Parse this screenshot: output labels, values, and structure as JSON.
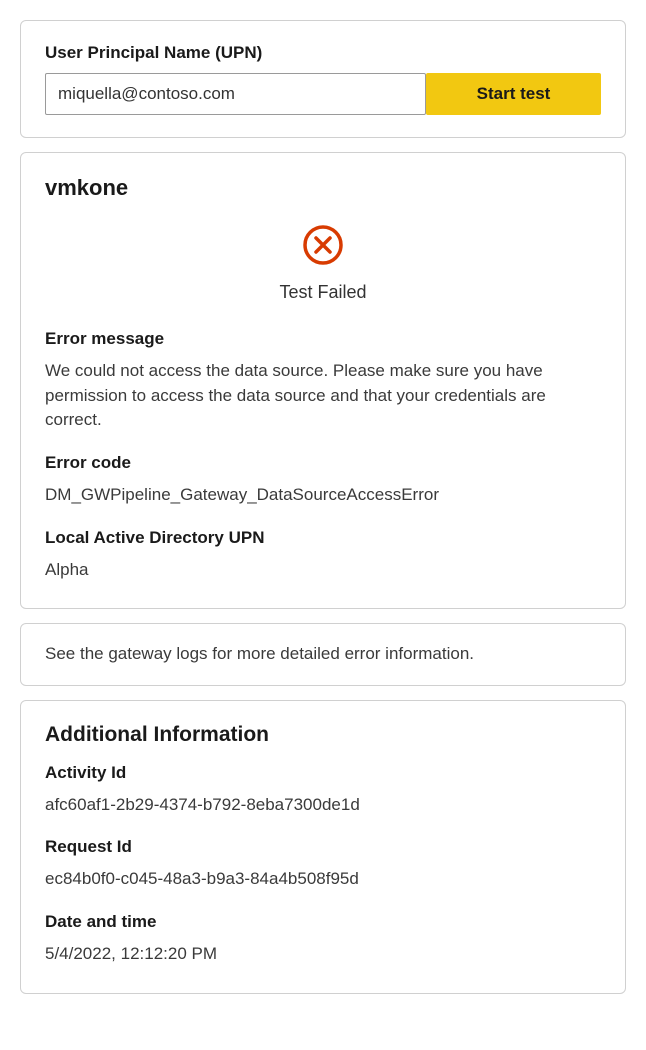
{
  "upn_section": {
    "label": "User Principal Name (UPN)",
    "value": "miquella@contoso.com",
    "button_label": "Start test"
  },
  "result": {
    "connection_name": "vmkone",
    "status_text": "Test Failed",
    "error_message_label": "Error message",
    "error_message": "We could not access the data source. Please make sure you have permission to access the data source and that your credentials are correct.",
    "error_code_label": "Error code",
    "error_code": "DM_GWPipeline_Gateway_DataSourceAccessError",
    "local_upn_label": "Local Active Directory UPN",
    "local_upn": "Alpha"
  },
  "logs_notice": "See the gateway logs for more detailed error information.",
  "additional": {
    "title": "Additional Information",
    "activity_id_label": "Activity Id",
    "activity_id": "afc60af1-2b29-4374-b792-8eba7300de1d",
    "request_id_label": "Request Id",
    "request_id": "ec84b0f0-c045-48a3-b9a3-84a4b508f95d",
    "datetime_label": "Date and time",
    "datetime": "5/4/2022, 12:12:20 PM"
  }
}
